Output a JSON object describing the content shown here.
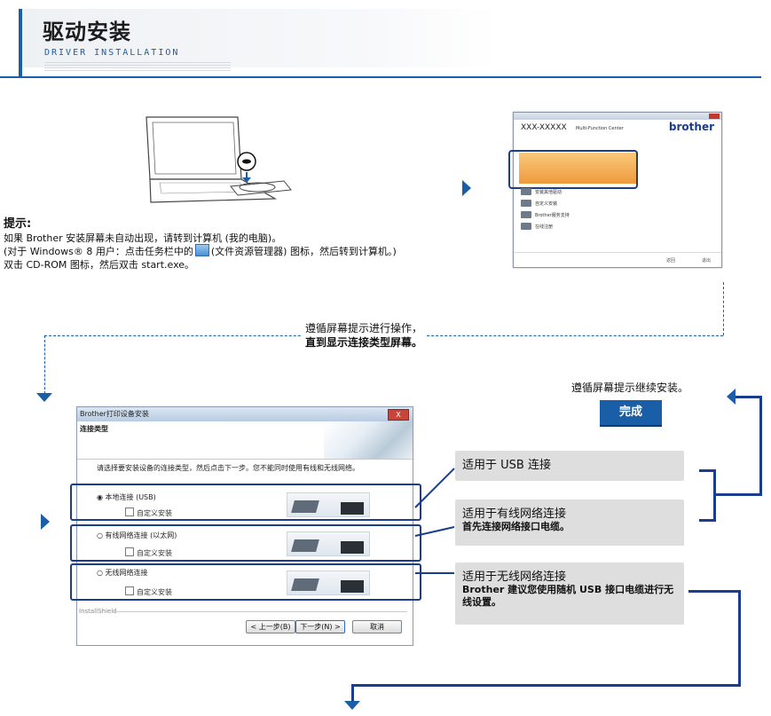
{
  "header": {
    "title": "驱动安装",
    "subtitle": "DRIVER INSTALLATION"
  },
  "tip": {
    "title": "提示:",
    "line1": "如果 Brother 安装屏幕未自动出现，请转到计算机 (我的电脑)。",
    "line2_a": "(对于 Windows® 8 用户：点击任务栏中的",
    "line2_b": "(文件资源管理器) 图标，然后转到计算机。)",
    "line3": "双击 CD-ROM 图标，然后双击 start.exe。"
  },
  "brother_center": {
    "model": "XXX-XXXXX",
    "subtitle": "Multi-Function Center",
    "logo": "brother",
    "rows": [
      "安装其他驱动",
      "自定义安装",
      "Brother服务支持",
      "在线注册"
    ],
    "back": "返回",
    "exit": "退出"
  },
  "instructions": {
    "line1": "遵循屏幕提示进行操作，",
    "line2": "直到显示连接类型屏幕。"
  },
  "dialog": {
    "titlebar": "Brother打印设备安装",
    "close": "X",
    "header": "连接类型",
    "instruction": "请选择要安装设备的连接类型，然后点击下一步。您不能同时使用有线和无线网络。",
    "options": [
      {
        "label": "本地连接 (USB)",
        "custom": "自定义安装",
        "selected": true
      },
      {
        "label": "有线网络连接 (以太网)",
        "custom": "自定义安装",
        "selected": false
      },
      {
        "label": "无线网络连接",
        "custom": "自定义安装",
        "selected": false
      }
    ],
    "installshield": "InstallShield",
    "back_button": "< 上一步(B)",
    "next_button": "下一步(N) >",
    "cancel_button": "取消"
  },
  "callouts": {
    "usb": {
      "title": "适用于 USB 连接"
    },
    "wired": {
      "title": "适用于有线网络连接",
      "sub": "首先连接网络接口电缆。"
    },
    "wireless": {
      "title": "适用于无线网络连接",
      "sub": "Brother 建议您使用随机 USB 接口电缆进行无线设置。"
    }
  },
  "finish": {
    "text": "遵循屏幕提示继续安装。",
    "button": "完成"
  },
  "colors": {
    "accent": "#1a5ea8",
    "dark_blue": "#1a3d8f",
    "callout_bg": "#dedede"
  }
}
